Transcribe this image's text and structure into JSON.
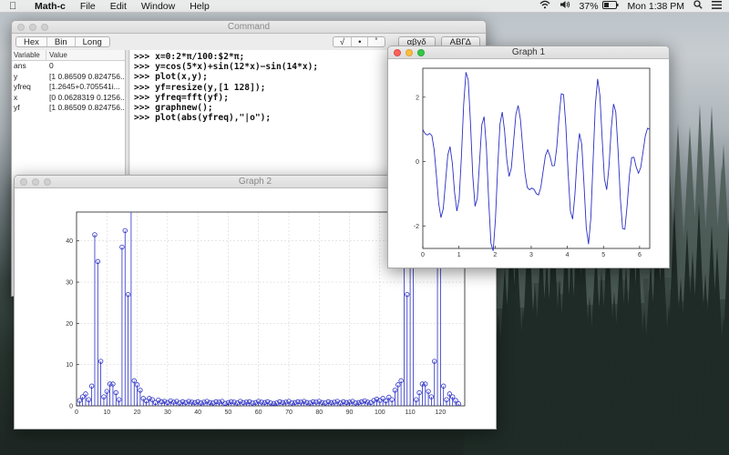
{
  "menubar": {
    "app_name": "Math-c",
    "menus": [
      "File",
      "Edit",
      "Window",
      "Help"
    ],
    "battery": "37%",
    "clock": "Mon 1:38 PM",
    "icons": [
      "apple-icon",
      "wifi-icon",
      "volume-icon",
      "battery-icon",
      "search-icon",
      "list-icon"
    ]
  },
  "command_window": {
    "title": "Command",
    "base_buttons": [
      "Hex",
      "Bin",
      "Long"
    ],
    "symbol_buttons": [
      "√",
      "•",
      "˚"
    ],
    "greek_lower": "αβγδ",
    "greek_upper": "ΑΒΓΔ",
    "variables": {
      "headers": [
        "Variable",
        "Value"
      ],
      "rows": [
        {
          "name": "ans",
          "value": "0"
        },
        {
          "name": "y",
          "value": "[1 0.86509 0.824756..."
        },
        {
          "name": "yfreq",
          "value": "[1.2645+0.705541i..."
        },
        {
          "name": "x",
          "value": "[0 0.0628319 0.1256..."
        },
        {
          "name": "yf",
          "value": "[1 0.86509 0.824756..."
        }
      ]
    },
    "console_lines": [
      ">>> x=0:2*π/100:$2*π;",
      ">>> y=cos(5*x)+sin(12*x)−sin(14*x);",
      ">>> plot(x,y);",
      ">>> yf=resize(y,[1 128]);",
      ">>> yfreq=fft(yf);",
      ">>> graphnew();",
      ">>> plot(abs(yfreq),\"|o\");"
    ]
  },
  "graph1": {
    "title": "Graph 1",
    "chart_data": {
      "type": "line",
      "xlim": [
        0,
        6.28
      ],
      "ylim": [
        -2.7,
        2.9
      ],
      "xticks": [
        0,
        1,
        2,
        3,
        4,
        5,
        6
      ],
      "yticks": [
        -2,
        0,
        2
      ],
      "color": "#2b2fc4",
      "grid": false,
      "formula": "y=cos(5*x)+sin(12*x)−sin(14*x)"
    }
  },
  "graph2": {
    "title": "Graph 2",
    "chart_data": {
      "type": "scatter",
      "style": "stem-with-circle-markers",
      "xlim": [
        0,
        128
      ],
      "ylim": [
        0,
        47
      ],
      "xticks": [
        0,
        10,
        20,
        30,
        40,
        50,
        60,
        70,
        80,
        90,
        100,
        110,
        120
      ],
      "yticks": [
        0,
        10,
        20,
        30,
        40
      ],
      "color": "#2b2fc4",
      "grid": true,
      "x": [
        1,
        2,
        3,
        4,
        5,
        6,
        7,
        8,
        9,
        10,
        11,
        12,
        13,
        14,
        15,
        16,
        17,
        18,
        19,
        20,
        21,
        22,
        23,
        24,
        25,
        26,
        27,
        28,
        29,
        30,
        31,
        32,
        33,
        34,
        35,
        36,
        37,
        38,
        39,
        40,
        41,
        42,
        43,
        44,
        45,
        46,
        47,
        48,
        49,
        50,
        51,
        52,
        53,
        54,
        55,
        56,
        57,
        58,
        59,
        60,
        61,
        62,
        63,
        64,
        65,
        66,
        67,
        68,
        69,
        70,
        71,
        72,
        73,
        74,
        75,
        76,
        77,
        78,
        79,
        80,
        81,
        82,
        83,
        84,
        85,
        86,
        87,
        88,
        89,
        90,
        91,
        92,
        93,
        94,
        95,
        96,
        97,
        98,
        99,
        100,
        101,
        102,
        103,
        104,
        105,
        106,
        107,
        108,
        109,
        110,
        111,
        112,
        113,
        114,
        115,
        116,
        117,
        118,
        119,
        120,
        121,
        122,
        123,
        124,
        125,
        126,
        127,
        128
      ],
      "values": [
        1.3,
        2.2,
        2.9,
        1.5,
        4.8,
        41.5,
        35,
        10.8,
        2.2,
        3.5,
        5.3,
        5.3,
        3.2,
        1.5,
        38.5,
        42.5,
        27,
        50,
        6.1,
        5.1,
        3.8,
        1.8,
        1.2,
        1.8,
        1.5,
        0.8,
        1.4,
        1,
        1.1,
        0.8,
        1.2,
        0.9,
        1.1,
        0.7,
        1,
        0.8,
        1.1,
        0.9,
        0.8,
        1,
        0.7,
        0.9,
        1.1,
        0.8,
        0.7,
        1,
        0.9,
        1.1,
        0.6,
        0.8,
        1,
        0.9,
        0.7,
        1.1,
        0.8,
        0.9,
        1,
        0.7,
        0.8,
        1.1,
        0.9,
        0.8,
        1,
        0.7,
        0.6,
        0.7,
        1,
        0.8,
        0.9,
        1.1,
        0.7,
        0.8,
        1,
        0.9,
        1.1,
        0.8,
        0.7,
        1,
        0.9,
        1.1,
        0.8,
        0.7,
        1,
        0.8,
        0.9,
        1.1,
        0.7,
        1,
        0.8,
        0.9,
        1.1,
        0.7,
        0.8,
        1,
        1.2,
        0.9,
        0.8,
        1.3,
        1.6,
        1.3,
        1.8,
        1.2,
        2.1,
        1.5,
        3.8,
        5.1,
        6.1,
        50,
        27,
        42.5,
        38.5,
        1.5,
        3.2,
        5.3,
        5.3,
        3.5,
        2.2,
        10.8,
        35,
        41.5,
        4.8,
        1.5,
        2.9,
        2.2,
        1.3,
        0.5
      ]
    }
  }
}
